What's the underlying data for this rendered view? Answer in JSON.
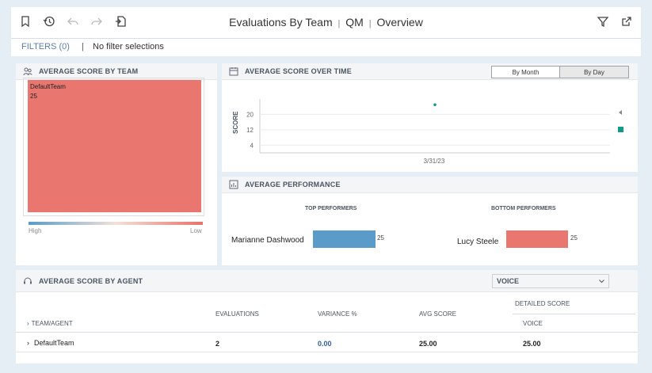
{
  "header": {
    "title_part1": "Evaluations By Team",
    "title_part2": "QM",
    "title_part3": "Overview",
    "sep": "|"
  },
  "filters": {
    "label": "FILTERS (0)",
    "pipe": "|",
    "value": "No filter selections"
  },
  "team_panel": {
    "title": "AVERAGE SCORE BY TEAM",
    "team_name": "DefaultTeam",
    "team_score": "25",
    "legend_high": "High",
    "legend_low": "Low",
    "colors": {
      "cell": "#ea7670",
      "high": "#5a9bc9",
      "low": "#e8716b"
    }
  },
  "time_panel": {
    "title": "AVERAGE SCORE OVER TIME",
    "toggle_month": "By Month",
    "toggle_day": "By Day",
    "ylabel": "SCORE",
    "yticks": [
      "20",
      "12",
      "4"
    ],
    "xtick": "3/31/23"
  },
  "chart_data": {
    "type": "scatter",
    "title": "AVERAGE SCORE OVER TIME",
    "xlabel": "",
    "ylabel": "SCORE",
    "x": [
      "3/31/23"
    ],
    "series": [
      {
        "values": [
          25
        ]
      }
    ],
    "yticks": [
      4,
      12,
      20
    ],
    "color": "#0f9a8a"
  },
  "performance_panel": {
    "title": "AVERAGE PERFORMANCE",
    "top_label": "TOP PERFORMERS",
    "bottom_label": "BOTTOM PERFORMERS",
    "top_name": "Marianne Dashwood",
    "top_value": "25",
    "bottom_name": "Lucy Steele",
    "bottom_value": "25",
    "colors": {
      "top": "#5a9bc9",
      "bottom": "#ea7670"
    }
  },
  "agent_panel": {
    "title": "AVERAGE SCORE BY AGENT",
    "select_value": "VOICE",
    "headers": {
      "team_agent": "TEAM/AGENT",
      "evaluations": "EVALUATIONS",
      "variance": "VARIANCE %",
      "avg_score": "AVG SCORE",
      "detailed_score": "DETAILED SCORE",
      "voice": "VOICE"
    },
    "rows": [
      {
        "team": "DefaultTeam",
        "evaluations": "2",
        "variance": "0.00",
        "avg_score": "25.00",
        "voice": "25.00"
      }
    ]
  }
}
